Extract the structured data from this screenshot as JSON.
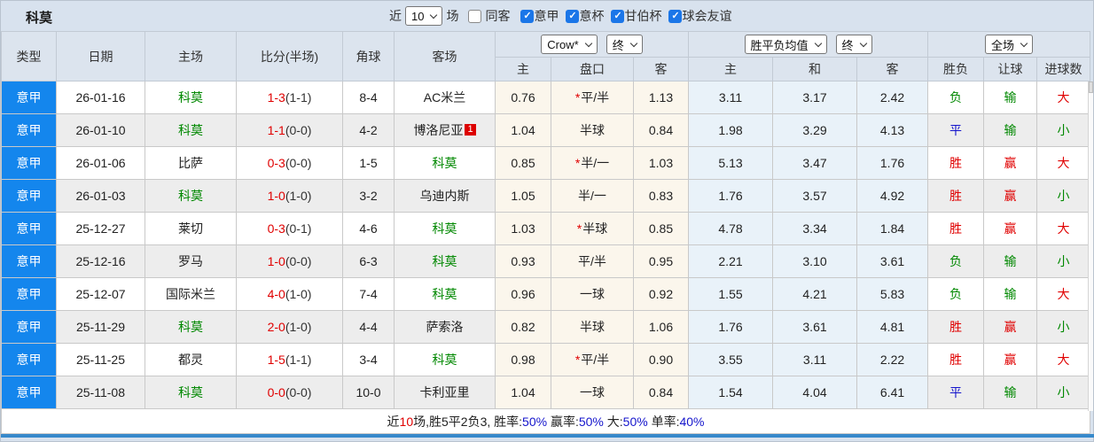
{
  "title": "科莫",
  "palette": {
    "red": "#e00000",
    "green": "#008800",
    "blue": "#1515cc",
    "black": "#222222",
    "type_bg": "#1486ed",
    "checkbox_blue": "#1b76e8",
    "header_bg": "#dce4ee",
    "page_bg": "#d8e2ee",
    "row_alt": "#ededed",
    "cream": "#fbf6ec",
    "lblue": "#e9f2f9",
    "bottom_bar": "#3789cb"
  },
  "controls": {
    "recent_label": "近",
    "recent_value": "10",
    "games_label": "场",
    "same_away": {
      "id": "same-away",
      "label": "同客",
      "checked": false
    },
    "filters": [
      {
        "id": "serie-a",
        "label": "意甲",
        "checked": true
      },
      {
        "id": "coppa-italia",
        "label": "意杯",
        "checked": true
      },
      {
        "id": "gamper-cup",
        "label": "甘伯杯",
        "checked": true
      },
      {
        "id": "club-friendly",
        "label": "球会友谊",
        "checked": true
      }
    ]
  },
  "header": {
    "type": "类型",
    "date": "日期",
    "home": "主场",
    "score": "比分(半场)",
    "corner": "角球",
    "away": "客场",
    "odds_source": "Crow*",
    "odds_time": "终",
    "avg_label": "胜平负均值",
    "avg_time": "终",
    "scope": "全场",
    "sub": {
      "home_odds": "主",
      "handicap": "盘口",
      "away_odds": "客",
      "avg_home": "主",
      "avg_draw": "和",
      "avg_away": "客",
      "result": "胜负",
      "handicap_result": "让球",
      "goals": "进球数"
    }
  },
  "rows": [
    {
      "type": "意甲",
      "date": "26-01-16",
      "home": {
        "name": "科莫",
        "highlight": true
      },
      "score": {
        "full": "1-3",
        "half": "(1-1)"
      },
      "corner": "8-4",
      "away": {
        "name": "AC米兰",
        "highlight": false,
        "badge": null
      },
      "odds": {
        "home": "0.76",
        "star": true,
        "handicap": "平/半",
        "away": "1.13"
      },
      "avg": {
        "home": "3.11",
        "draw": "3.17",
        "away": "2.42"
      },
      "result": {
        "text": "负",
        "color": "green"
      },
      "handicap_result": {
        "text": "输",
        "color": "green"
      },
      "goals": {
        "text": "大",
        "color": "red"
      }
    },
    {
      "type": "意甲",
      "date": "26-01-10",
      "home": {
        "name": "科莫",
        "highlight": true
      },
      "score": {
        "full": "1-1",
        "half": "(0-0)"
      },
      "corner": "4-2",
      "away": {
        "name": "博洛尼亚",
        "highlight": false,
        "badge": "1"
      },
      "odds": {
        "home": "1.04",
        "star": false,
        "handicap": "半球",
        "away": "0.84"
      },
      "avg": {
        "home": "1.98",
        "draw": "3.29",
        "away": "4.13"
      },
      "result": {
        "text": "平",
        "color": "blue"
      },
      "handicap_result": {
        "text": "输",
        "color": "green"
      },
      "goals": {
        "text": "小",
        "color": "green"
      }
    },
    {
      "type": "意甲",
      "date": "26-01-06",
      "home": {
        "name": "比萨",
        "highlight": false
      },
      "score": {
        "full": "0-3",
        "half": "(0-0)"
      },
      "corner": "1-5",
      "away": {
        "name": "科莫",
        "highlight": true,
        "badge": null
      },
      "odds": {
        "home": "0.85",
        "star": true,
        "handicap": "半/一",
        "away": "1.03"
      },
      "avg": {
        "home": "5.13",
        "draw": "3.47",
        "away": "1.76"
      },
      "result": {
        "text": "胜",
        "color": "red"
      },
      "handicap_result": {
        "text": "赢",
        "color": "red"
      },
      "goals": {
        "text": "大",
        "color": "red"
      }
    },
    {
      "type": "意甲",
      "date": "26-01-03",
      "home": {
        "name": "科莫",
        "highlight": true
      },
      "score": {
        "full": "1-0",
        "half": "(1-0)"
      },
      "corner": "3-2",
      "away": {
        "name": "乌迪内斯",
        "highlight": false,
        "badge": null
      },
      "odds": {
        "home": "1.05",
        "star": false,
        "handicap": "半/一",
        "away": "0.83"
      },
      "avg": {
        "home": "1.76",
        "draw": "3.57",
        "away": "4.92"
      },
      "result": {
        "text": "胜",
        "color": "red"
      },
      "handicap_result": {
        "text": "赢",
        "color": "red"
      },
      "goals": {
        "text": "小",
        "color": "green"
      }
    },
    {
      "type": "意甲",
      "date": "25-12-27",
      "home": {
        "name": "莱切",
        "highlight": false
      },
      "score": {
        "full": "0-3",
        "half": "(0-1)"
      },
      "corner": "4-6",
      "away": {
        "name": "科莫",
        "highlight": true,
        "badge": null
      },
      "odds": {
        "home": "1.03",
        "star": true,
        "handicap": "半球",
        "away": "0.85"
      },
      "avg": {
        "home": "4.78",
        "draw": "3.34",
        "away": "1.84"
      },
      "result": {
        "text": "胜",
        "color": "red"
      },
      "handicap_result": {
        "text": "赢",
        "color": "red"
      },
      "goals": {
        "text": "大",
        "color": "red"
      }
    },
    {
      "type": "意甲",
      "date": "25-12-16",
      "home": {
        "name": "罗马",
        "highlight": false
      },
      "score": {
        "full": "1-0",
        "half": "(0-0)"
      },
      "corner": "6-3",
      "away": {
        "name": "科莫",
        "highlight": true,
        "badge": null
      },
      "odds": {
        "home": "0.93",
        "star": false,
        "handicap": "平/半",
        "away": "0.95"
      },
      "avg": {
        "home": "2.21",
        "draw": "3.10",
        "away": "3.61"
      },
      "result": {
        "text": "负",
        "color": "green"
      },
      "handicap_result": {
        "text": "输",
        "color": "green"
      },
      "goals": {
        "text": "小",
        "color": "green"
      }
    },
    {
      "type": "意甲",
      "date": "25-12-07",
      "home": {
        "name": "国际米兰",
        "highlight": false
      },
      "score": {
        "full": "4-0",
        "half": "(1-0)"
      },
      "corner": "7-4",
      "away": {
        "name": "科莫",
        "highlight": true,
        "badge": null
      },
      "odds": {
        "home": "0.96",
        "star": false,
        "handicap": "一球",
        "away": "0.92"
      },
      "avg": {
        "home": "1.55",
        "draw": "4.21",
        "away": "5.83"
      },
      "result": {
        "text": "负",
        "color": "green"
      },
      "handicap_result": {
        "text": "输",
        "color": "green"
      },
      "goals": {
        "text": "大",
        "color": "red"
      }
    },
    {
      "type": "意甲",
      "date": "25-11-29",
      "home": {
        "name": "科莫",
        "highlight": true
      },
      "score": {
        "full": "2-0",
        "half": "(1-0)"
      },
      "corner": "4-4",
      "away": {
        "name": "萨索洛",
        "highlight": false,
        "badge": null
      },
      "odds": {
        "home": "0.82",
        "star": false,
        "handicap": "半球",
        "away": "1.06"
      },
      "avg": {
        "home": "1.76",
        "draw": "3.61",
        "away": "4.81"
      },
      "result": {
        "text": "胜",
        "color": "red"
      },
      "handicap_result": {
        "text": "赢",
        "color": "red"
      },
      "goals": {
        "text": "小",
        "color": "green"
      }
    },
    {
      "type": "意甲",
      "date": "25-11-25",
      "home": {
        "name": "都灵",
        "highlight": false
      },
      "score": {
        "full": "1-5",
        "half": "(1-1)"
      },
      "corner": "3-4",
      "away": {
        "name": "科莫",
        "highlight": true,
        "badge": null
      },
      "odds": {
        "home": "0.98",
        "star": true,
        "handicap": "平/半",
        "away": "0.90"
      },
      "avg": {
        "home": "3.55",
        "draw": "3.11",
        "away": "2.22"
      },
      "result": {
        "text": "胜",
        "color": "red"
      },
      "handicap_result": {
        "text": "赢",
        "color": "red"
      },
      "goals": {
        "text": "大",
        "color": "red"
      }
    },
    {
      "type": "意甲",
      "date": "25-11-08",
      "home": {
        "name": "科莫",
        "highlight": true
      },
      "score": {
        "full": "0-0",
        "half": "(0-0)"
      },
      "corner": "10-0",
      "away": {
        "name": "卡利亚里",
        "highlight": false,
        "badge": null
      },
      "odds": {
        "home": "1.04",
        "star": false,
        "handicap": "一球",
        "away": "0.84"
      },
      "avg": {
        "home": "1.54",
        "draw": "4.04",
        "away": "6.41"
      },
      "result": {
        "text": "平",
        "color": "blue"
      },
      "handicap_result": {
        "text": "输",
        "color": "green"
      },
      "goals": {
        "text": "小",
        "color": "green"
      }
    }
  ],
  "footer": {
    "segments": [
      {
        "text": "近",
        "color": "black"
      },
      {
        "text": "10",
        "color": "red"
      },
      {
        "text": "场,胜5平2负3, 胜率:",
        "color": "black"
      },
      {
        "text": "50%",
        "color": "blue"
      },
      {
        "text": " 赢率:",
        "color": "black"
      },
      {
        "text": "50%",
        "color": "blue"
      },
      {
        "text": " 大:",
        "color": "black"
      },
      {
        "text": "50%",
        "color": "blue"
      },
      {
        "text": " 单率:",
        "color": "black"
      },
      {
        "text": "40%",
        "color": "blue"
      }
    ]
  }
}
